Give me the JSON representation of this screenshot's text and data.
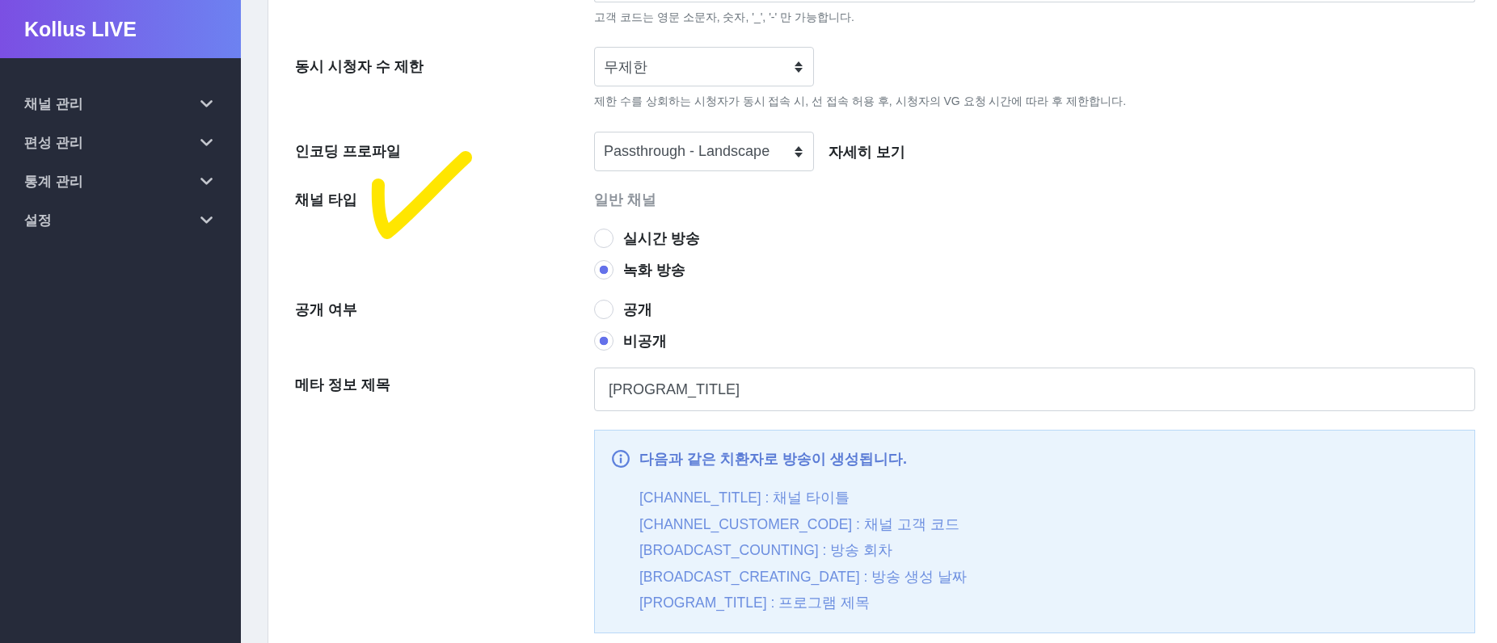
{
  "sidebar": {
    "brand": "Kollus LIVE",
    "items": [
      {
        "label": "채널 관리",
        "expanded": false
      },
      {
        "label": "편성 관리",
        "expanded": false
      },
      {
        "label": "통계 관리",
        "expanded": false
      },
      {
        "label": "설정",
        "expanded": false
      }
    ]
  },
  "form": {
    "top_field": {
      "hint": "고객 코드는 영문 소문자, 숫자, '_', '-' 만 가능합니다."
    },
    "rows": [
      {
        "kind": "select",
        "label": "동시 시청자 수 제한",
        "value": "무제한",
        "hint": "제한 수를 상회하는 시청자가 동시 접속 시, 선 접속 허용 후, 시청자의 VG 요청 시간에 따라 후 제한합니다."
      },
      {
        "kind": "select",
        "label": "인코딩 프로파일",
        "value": "Passthrough - Landscape",
        "link": "자세히 보기"
      },
      {
        "kind": "radio",
        "label": "채널 타입",
        "note": "일반 채널",
        "options": [
          {
            "label": "실시간 방송",
            "selected": false
          },
          {
            "label": "녹화 방송",
            "selected": true
          }
        ]
      },
      {
        "kind": "radio",
        "label": "공개 여부",
        "options": [
          {
            "label": "공개",
            "selected": false
          },
          {
            "label": "비공개",
            "selected": true
          }
        ]
      },
      {
        "kind": "text",
        "label": "메타 정보 제목",
        "value": "[PROGRAM_TITLE]"
      },
      {
        "kind": "info",
        "title": "다음과 같은 치환자로 방송이 생성됩니다.",
        "lines": [
          "[CHANNEL_TITLE] : 채널 타이틀",
          "[CHANNEL_CUSTOMER_CODE] : 채널 고객 코드",
          "[BROADCAST_COUNTING] : 방송 회차",
          "[BROADCAST_CREATING_DATE] : 방송 생성 날짜",
          "[PROGRAM_TITLE] : 프로그램 제목"
        ]
      }
    ]
  }
}
